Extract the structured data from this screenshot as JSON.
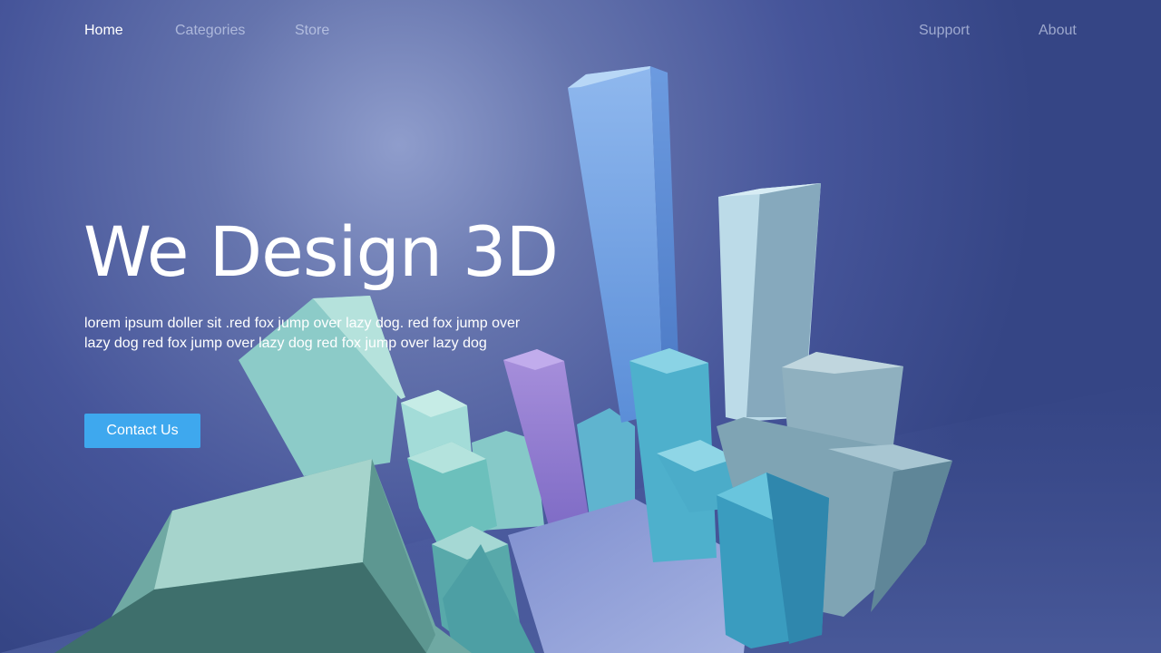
{
  "nav": {
    "items": [
      {
        "label": "Home"
      },
      {
        "label": "Categories"
      },
      {
        "label": "Store"
      },
      {
        "label": "Support"
      },
      {
        "label": "About"
      }
    ]
  },
  "hero": {
    "title": "We Design 3D",
    "description": "lorem ipsum doller sit .red fox jump over lazy dog. red fox jump over lazy dog red fox jump over lazy dog red fox jump over lazy dog",
    "cta_label": "Contact Us"
  },
  "colors": {
    "background": "#3f4f8f",
    "accent": "#3ea8ee",
    "text": "#ffffff",
    "nav_inactive": "#aab4d4"
  }
}
